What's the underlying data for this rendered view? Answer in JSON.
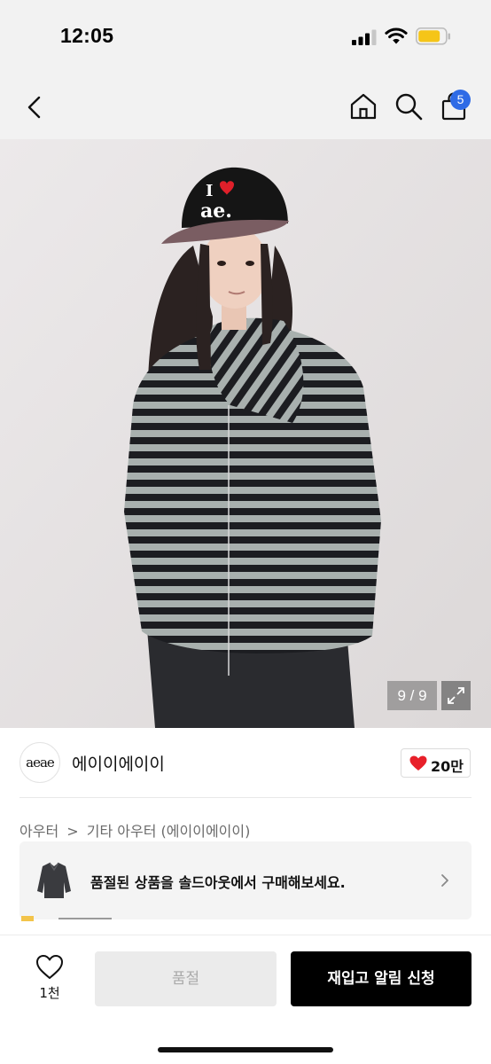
{
  "status_bar": {
    "time": "12:05",
    "icons": [
      "cellular-signal-icon",
      "wifi-icon",
      "battery-icon"
    ],
    "battery_color": "#f5c518"
  },
  "nav": {
    "icons": [
      "back-chevron-icon",
      "home-icon",
      "search-icon",
      "shopping-bag-icon"
    ],
    "cart_badge": "5",
    "badge_color": "#2f6be6"
  },
  "gallery": {
    "counter": "9 / 9",
    "expand_icon": "expand-arrows-icon",
    "cap_text_line1": "I",
    "cap_text_line2": "ae."
  },
  "brand": {
    "logo_text": "aeae",
    "name": "에이이에이이",
    "like_count": "20만",
    "like_color": "#e8202a"
  },
  "breadcrumb": {
    "category": "아우터",
    "separator": ">",
    "subcategory": "기타 아우터",
    "brand": "(에이이에이이)"
  },
  "soldout_banner": {
    "text": "품절된 상품을 솔드아웃에서 구매해보세요.",
    "icon": "chevron-right-icon"
  },
  "bottom_bar": {
    "wish_count": "1천",
    "soldout_label": "품절",
    "restock_label": "재입고 알림 신청"
  }
}
